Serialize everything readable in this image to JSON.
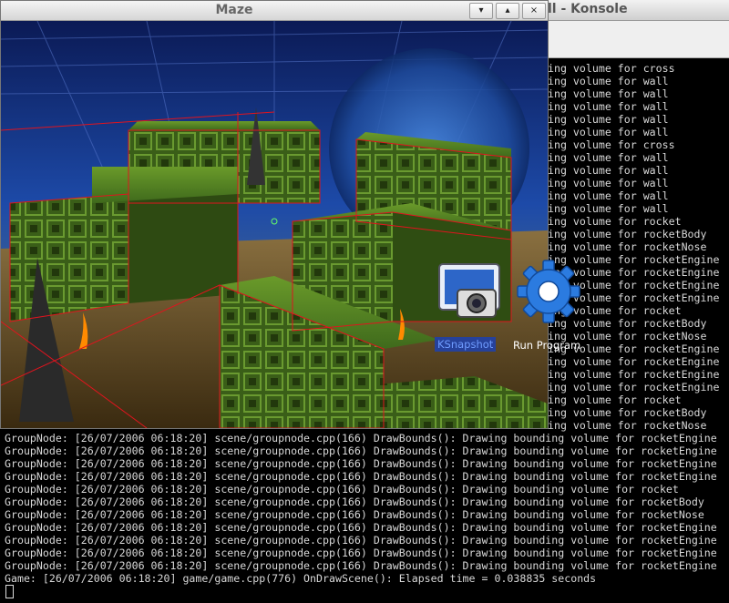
{
  "konsole": {
    "title": "ll - Konsole",
    "right_lines": [
      "ing volume for cross",
      "ing volume for wall",
      "ing volume for wall",
      "ing volume for wall",
      "ing volume for wall",
      "ing volume for wall",
      "ing volume for cross",
      "ing volume for wall",
      "ing volume for wall",
      "ing volume for wall",
      "ing volume for wall",
      "ing volume for wall",
      "ing volume for rocket",
      "ing volume for rocketBody",
      "ing volume for rocketNose",
      "ing volume for rocketEngine",
      "ing volume for rocketEngine",
      "ing volume for rocketEngine",
      "ing volume for rocketEngine",
      "ing volume for rocket",
      "ing volume for rocketBody",
      "ing volume for rocketNose",
      "ing volume for rocketEngine",
      "ing volume for rocketEngine",
      "ing volume for rocketEngine",
      "ing volume for rocketEngine",
      "ing volume for rocket",
      "ing volume for rocketBody",
      "ing volume for rocketNose"
    ],
    "bottom_lines": [
      "GroupNode: [26/07/2006 06:18:20] scene/groupnode.cpp(166) DrawBounds(): Drawing bounding volume for rocketEngine",
      "GroupNode: [26/07/2006 06:18:20] scene/groupnode.cpp(166) DrawBounds(): Drawing bounding volume for rocketEngine",
      "GroupNode: [26/07/2006 06:18:20] scene/groupnode.cpp(166) DrawBounds(): Drawing bounding volume for rocketEngine",
      "GroupNode: [26/07/2006 06:18:20] scene/groupnode.cpp(166) DrawBounds(): Drawing bounding volume for rocketEngine",
      "GroupNode: [26/07/2006 06:18:20] scene/groupnode.cpp(166) DrawBounds(): Drawing bounding volume for rocket",
      "GroupNode: [26/07/2006 06:18:20] scene/groupnode.cpp(166) DrawBounds(): Drawing bounding volume for rocketBody",
      "GroupNode: [26/07/2006 06:18:20] scene/groupnode.cpp(166) DrawBounds(): Drawing bounding volume for rocketNose",
      "GroupNode: [26/07/2006 06:18:20] scene/groupnode.cpp(166) DrawBounds(): Drawing bounding volume for rocketEngine",
      "GroupNode: [26/07/2006 06:18:20] scene/groupnode.cpp(166) DrawBounds(): Drawing bounding volume for rocketEngine",
      "GroupNode: [26/07/2006 06:18:20] scene/groupnode.cpp(166) DrawBounds(): Drawing bounding volume for rocketEngine",
      "GroupNode: [26/07/2006 06:18:20] scene/groupnode.cpp(166) DrawBounds(): Drawing bounding volume for rocketEngine",
      "Game: [26/07/2006 06:18:20] game/game.cpp(776) OnDrawScene(): Elapsed time = 0.038835 seconds"
    ]
  },
  "maze": {
    "title": "Maze",
    "buttons": {
      "shade": "▾",
      "maximize": "▴",
      "close": "×"
    }
  },
  "desktop": {
    "ksnapshot_label": "KSnapshot",
    "run_program_label": "Run Program"
  },
  "colors": {
    "wall_green": "#3f6a1c",
    "bounds_red": "#e0141e",
    "sky_blue": "#1a3f8f"
  }
}
